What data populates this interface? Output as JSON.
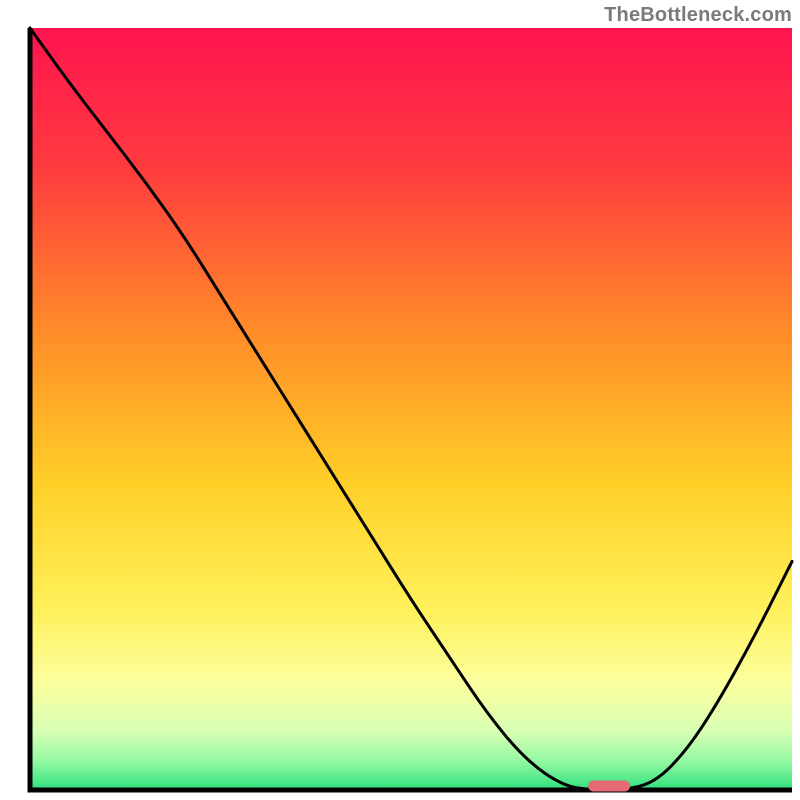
{
  "watermark": "TheBottleneck.com",
  "chart_data": {
    "type": "line",
    "description": "Bottleneck curve plotted over a vertical red-to-green gradient. X axis is an unlabeled parameter (0–100), Y axis is bottleneck severity percentage (0 = none/green, 100 = max/red). The curve descends from top-left, reaches a minimum near x≈75 where a small red pill marker sits on the green baseline, then rises again toward the right edge.",
    "x": [
      0,
      5,
      10,
      15,
      20,
      25,
      30,
      35,
      40,
      45,
      50,
      55,
      60,
      65,
      70,
      74,
      78,
      82,
      86,
      90,
      95,
      100
    ],
    "values": [
      100,
      93,
      86.5,
      80,
      73,
      65,
      57,
      49,
      41,
      33,
      25,
      17.5,
      10,
      4,
      0.5,
      0,
      0,
      1,
      5,
      11,
      20,
      30
    ],
    "xlim": [
      0,
      100
    ],
    "ylim": [
      0,
      100
    ],
    "xlabel": "",
    "ylabel": "",
    "marker": {
      "x": 76,
      "y": 0,
      "color": "#e46a73"
    },
    "gradient_stops": [
      {
        "offset": 0.0,
        "color": "#ff1450"
      },
      {
        "offset": 0.18,
        "color": "#ff3a3f"
      },
      {
        "offset": 0.4,
        "color": "#ff8c28"
      },
      {
        "offset": 0.6,
        "color": "#ffd028"
      },
      {
        "offset": 0.76,
        "color": "#fff05a"
      },
      {
        "offset": 0.86,
        "color": "#fbff9e"
      },
      {
        "offset": 0.925,
        "color": "#d6ffb4"
      },
      {
        "offset": 0.965,
        "color": "#8cf7a0"
      },
      {
        "offset": 1.0,
        "color": "#2de07d"
      }
    ],
    "axis_color": "#000000",
    "curve_color": "#000000"
  }
}
